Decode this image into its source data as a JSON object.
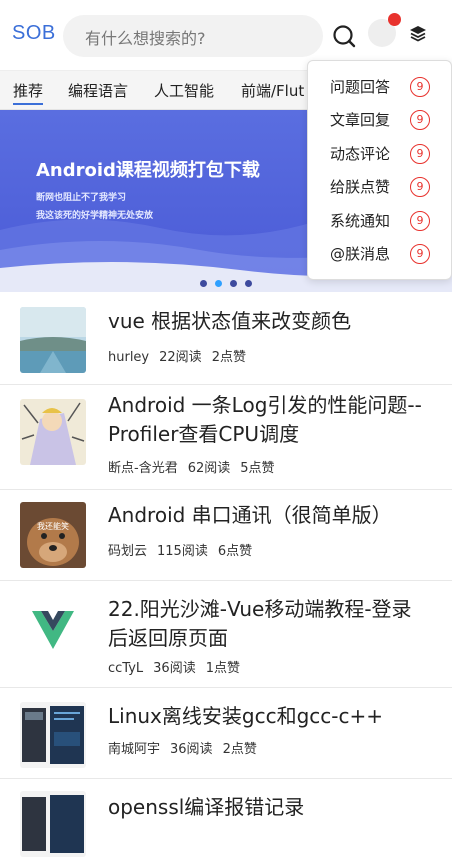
{
  "header": {
    "logo": "SOB",
    "search_placeholder": "有什么想搜索的?",
    "search_icon": "search-icon",
    "layers_icon": "layers-icon",
    "notification_dot_color": "#e8322d"
  },
  "tabs": [
    "推荐",
    "编程语言",
    "人工智能",
    "前端/Flut"
  ],
  "banner": {
    "title": "Android课程视频打包下载",
    "line1": "断网也阻止不了我学习",
    "line2": "我这该死的好学精神无处安放"
  },
  "dropdown": [
    {
      "label": "问题回答",
      "count": "9"
    },
    {
      "label": "文章回复",
      "count": "9"
    },
    {
      "label": "动态评论",
      "count": "9"
    },
    {
      "label": "给朕点赞",
      "count": "9"
    },
    {
      "label": "系统通知",
      "count": "9"
    },
    {
      "label": "@朕消息",
      "count": "9"
    }
  ],
  "articles": [
    {
      "title": "vue 根据状态值来改变颜色",
      "author": "hurley",
      "reads": "22阅读",
      "likes": "2点赞"
    },
    {
      "title": "Android 一条Log引发的性能问题--Profiler查看CPU调度",
      "author": "断点-含光君",
      "reads": "62阅读",
      "likes": "5点赞"
    },
    {
      "title": "Android 串口通讯（很简单版）",
      "author": "码划云",
      "reads": "115阅读",
      "likes": "6点赞"
    },
    {
      "title": "22.阳光沙滩-Vue移动端教程-登录后返回原页面",
      "author": "ccTyL",
      "reads": "36阅读",
      "likes": "1点赞"
    },
    {
      "title": "Linux离线安装gcc和gcc-c++",
      "author": "南城阿宇",
      "reads": "36阅读",
      "likes": "2点赞"
    },
    {
      "title": "openssl编译报错记录"
    }
  ],
  "thumb_caption": "我还能笑"
}
